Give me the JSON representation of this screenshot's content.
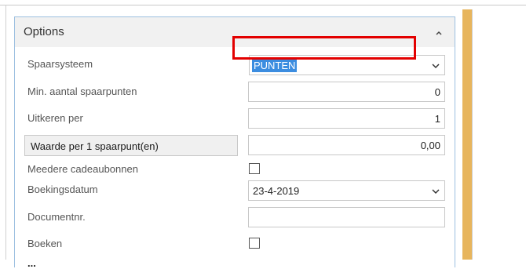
{
  "panel": {
    "title": "Options",
    "collapse_icon": "chevron-up-icon"
  },
  "rows": [
    {
      "label": "Spaarsysteem",
      "value": "PUNTEN",
      "control": "select"
    },
    {
      "label": "Min. aantal spaarpunten",
      "value": "0",
      "control": "number"
    },
    {
      "label": "Uitkeren per",
      "value": "1",
      "control": "number"
    },
    {
      "label": "Waarde per 1 spaarpunt(en)",
      "value": "0,00",
      "control": "number"
    },
    {
      "label": "Meedere cadeaubonnen",
      "checked": false,
      "control": "checkbox"
    },
    {
      "label": "Boekingsdatum",
      "value": "23-4-2019",
      "control": "date-select"
    },
    {
      "label": "Documentnr.",
      "value": "",
      "control": "text"
    },
    {
      "label": "Boeken",
      "checked": false,
      "control": "checkbox"
    }
  ],
  "footer": {
    "cut_off_label": "..."
  },
  "colors": {
    "selection": "#3c8de0",
    "focus_outline": "#e30000",
    "scrollbar": "#e7b55d",
    "panel_border": "#9cbfe0"
  }
}
